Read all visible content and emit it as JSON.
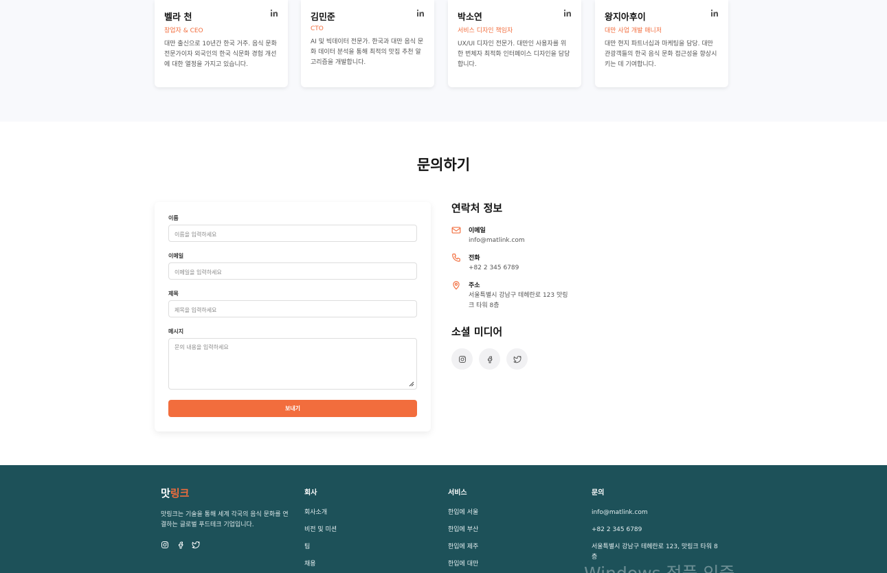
{
  "team": [
    {
      "name": "벨라 천",
      "role": "창업자 & CEO",
      "bio": "대만 출신으로 10년간 한국 거주. 음식 문화 전문가이자 외국인의 한국 식문화 경험 개선에 대한 열정을 가지고 있습니다."
    },
    {
      "name": "김민준",
      "role": "CTO",
      "bio": "AI 및 빅데이터 전문가. 한국과 대만 음식 문화 데이터 분석을 통해 최적의 맛집 추천 알고리즘을 개발합니다."
    },
    {
      "name": "박소연",
      "role": "서비스 디자인 책임자",
      "bio": "UX/UI 디자인 전문가. 대만인 사용자를 위한 번체자 최적화 인터페이스 디자인을 담당합니다."
    },
    {
      "name": "왕지아후이",
      "role": "대만 사업 개발 매니저",
      "bio": "대만 현지 파트너십과 마케팅을 담당. 대만 관광객들의 한국 음식 문화 접근성을 향상시키는 데 기여합니다."
    }
  ],
  "contact": {
    "title": "문의하기",
    "form": {
      "name_label": "이름",
      "name_placeholder": "이름을 입력하세요",
      "email_label": "이메일",
      "email_placeholder": "이메일을 입력하세요",
      "subject_label": "제목",
      "subject_placeholder": "제목을 입력하세요",
      "message_label": "메시지",
      "message_placeholder": "문의 내용을 입력하세요",
      "submit": "보내기"
    },
    "info_title": "연락처 정보",
    "email_label": "이메일",
    "email_value": "info@matlink.com",
    "phone_label": "전화",
    "phone_value": "+82 2 345 6789",
    "address_label": "주소",
    "address_value": "서울특별시 강남구 테헤란로 123 맛링크 타워 8층",
    "social_title": "소셜 미디어"
  },
  "footer": {
    "logo_main": "맛",
    "logo_accent": "링크",
    "description": "맛링크는 기술을 통해 세계 각국의 음식 문화를 연결하는 글로벌 푸드테크 기업입니다.",
    "company_title": "회사",
    "company_links": [
      "회사소개",
      "비전 및 미션",
      "팀",
      "채용"
    ],
    "services_title": "서비스",
    "services_links": [
      "한입에 서울",
      "한입에 부산",
      "한입에 제주",
      "한입에 대만"
    ],
    "contact_title": "문의",
    "contact_email": "info@matlink.com",
    "contact_phone": "+82 2 345 6789",
    "contact_address": "서울특별시 강남구 테헤란로 123, 맛링크 타워 8층",
    "watermark": "Windows 정품 인증"
  },
  "colors": {
    "accent": "#f26d3d",
    "footer_bg": "#1d5159"
  }
}
